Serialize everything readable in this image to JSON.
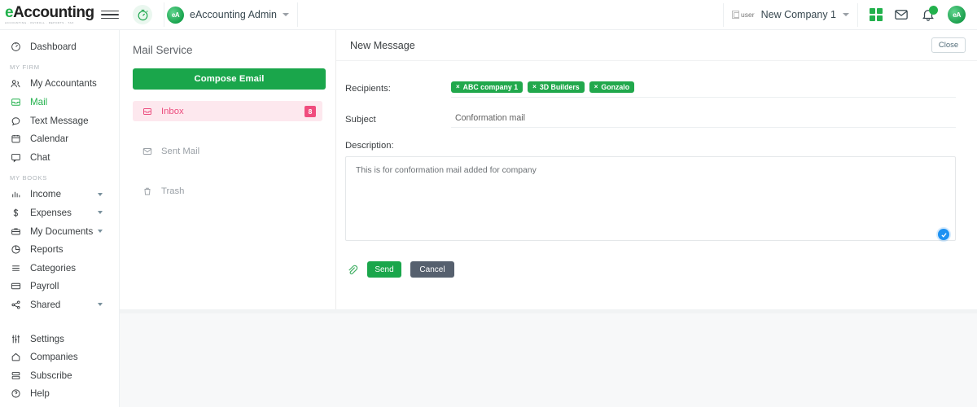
{
  "header": {
    "logo_main_e": "e",
    "logo_main_rest": "Accounting",
    "logo_sub": "accounting  ·  payroll  ·  reports  ·  tax",
    "menu_icon": "hamburger-icon",
    "timer_icon": "stopwatch-icon",
    "admin": {
      "avatar_text": "eA",
      "label": "eAccounting Admin"
    },
    "company": {
      "broken_image_alt": "user",
      "label": "New Company 1"
    },
    "icons": {
      "apps": "grid-apps-icon",
      "mail": "envelope-icon",
      "notifications": "bell-icon",
      "profile": "avatar-icon"
    },
    "profile_avatar_text": "eA"
  },
  "sidebar": {
    "items": [
      {
        "label": "Dashboard",
        "icon": "dashboard-icon",
        "active": false,
        "caret": false
      },
      {
        "label": "My Accountants",
        "icon": "users-icon",
        "active": false,
        "caret": false
      },
      {
        "label": "Mail",
        "icon": "inbox-icon",
        "active": true,
        "caret": false
      },
      {
        "label": "Text Message",
        "icon": "chat-bubble-icon",
        "active": false,
        "caret": false
      },
      {
        "label": "Calendar",
        "icon": "calendar-icon",
        "active": false,
        "caret": false
      },
      {
        "label": "Chat",
        "icon": "chat-icon",
        "active": false,
        "caret": false
      },
      {
        "label": "Income",
        "icon": "bar-chart-icon",
        "active": false,
        "caret": true
      },
      {
        "label": "Expenses",
        "icon": "dollar-icon",
        "active": false,
        "caret": true
      },
      {
        "label": "My Documents",
        "icon": "briefcase-icon",
        "active": false,
        "caret": true
      },
      {
        "label": "Reports",
        "icon": "pie-chart-icon",
        "active": false,
        "caret": false
      },
      {
        "label": "Categories",
        "icon": "list-icon",
        "active": false,
        "caret": false
      },
      {
        "label": "Payroll",
        "icon": "card-icon",
        "active": false,
        "caret": false
      },
      {
        "label": "Shared",
        "icon": "share-icon",
        "active": false,
        "caret": true
      },
      {
        "label": "Settings",
        "icon": "sliders-icon",
        "active": false,
        "caret": false
      },
      {
        "label": "Companies",
        "icon": "home-icon",
        "active": false,
        "caret": false
      },
      {
        "label": "Subscribe",
        "icon": "server-icon",
        "active": false,
        "caret": false
      },
      {
        "label": "Help",
        "icon": "help-circle-icon",
        "active": false,
        "caret": false
      }
    ],
    "section_my_firm": "MY FIRM",
    "section_my_books": "MY BOOKS"
  },
  "mail_service": {
    "title": "Mail Service",
    "compose_label": "Compose Email",
    "folders": [
      {
        "label": "Inbox",
        "icon": "inbox-icon",
        "badge": "8",
        "active": true
      },
      {
        "label": "Sent Mail",
        "icon": "sent-envelope-icon",
        "badge": "",
        "active": false
      },
      {
        "label": "Trash",
        "icon": "trash-icon",
        "badge": "",
        "active": false
      }
    ]
  },
  "new_message": {
    "title": "New Message",
    "close_label": "Close",
    "recipients_label": "Recipients:",
    "recipients": [
      {
        "remove": "×",
        "name": "ABC company 1"
      },
      {
        "remove": "×",
        "name": "3D Builders"
      },
      {
        "remove": "×",
        "name": "Gonzalo"
      }
    ],
    "subject_label": "Subject",
    "subject_value": "Conformation mail",
    "subject_placeholder": "Subject",
    "description_label": "Description:",
    "description_value": "This is for conformation mail added for company",
    "description_placeholder": "Description",
    "attach_icon": "paperclip-icon",
    "send_label": "Send",
    "cancel_label": "Cancel",
    "grammar_badge_icon": "check-circle-icon"
  },
  "colors": {
    "brand_green": "#1aa64b",
    "accent_pink": "#f04c7d",
    "cancel_slate": "#56606e",
    "grammar_blue": "#1c91f2"
  }
}
